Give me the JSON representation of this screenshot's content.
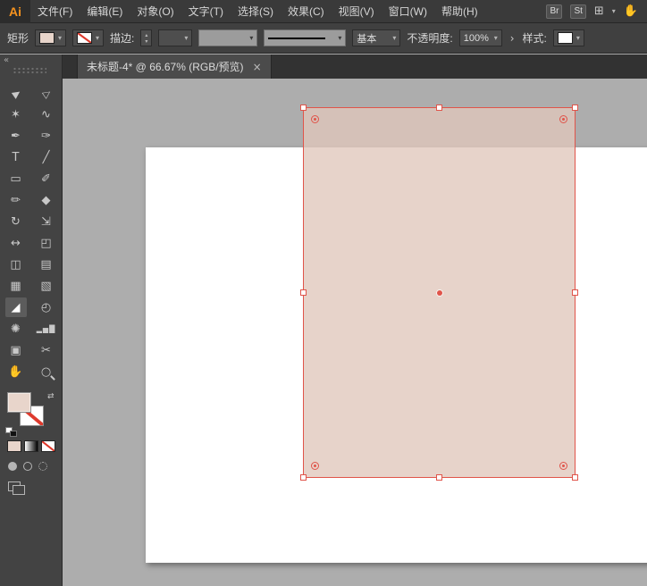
{
  "menubar": {
    "logo": "Ai",
    "items": [
      "文件(F)",
      "编辑(E)",
      "对象(O)",
      "文字(T)",
      "选择(S)",
      "效果(C)",
      "视图(V)",
      "窗口(W)",
      "帮助(H)"
    ],
    "br_badge": "Br",
    "st_badge": "St"
  },
  "controlbar": {
    "tool_label": "矩形",
    "stroke_label": "描边:",
    "brush_name": "基本",
    "opacity_label": "不透明度:",
    "opacity_value": "100%",
    "style_label": "样式:"
  },
  "tabbar": {
    "tab_title": "未标题-4* @ 66.67% (RGB/预览)"
  },
  "toolbar": {
    "tools": [
      {
        "name": "selection-tool",
        "glyph": "▶"
      },
      {
        "name": "direct-selection-tool",
        "glyph": "▷"
      },
      {
        "name": "magic-wand-tool",
        "glyph": "✶"
      },
      {
        "name": "lasso-tool",
        "glyph": "∿"
      },
      {
        "name": "pen-tool",
        "glyph": "✒"
      },
      {
        "name": "curvature-tool",
        "glyph": "✑"
      },
      {
        "name": "type-tool",
        "glyph": "T"
      },
      {
        "name": "line-segment-tool",
        "glyph": "╱"
      },
      {
        "name": "rectangle-tool",
        "glyph": "▭"
      },
      {
        "name": "paintbrush-tool",
        "glyph": "✐"
      },
      {
        "name": "pencil-tool",
        "glyph": "✏"
      },
      {
        "name": "eraser-tool",
        "glyph": "◆"
      },
      {
        "name": "rotate-tool",
        "glyph": "↻"
      },
      {
        "name": "scale-tool",
        "glyph": "⇲"
      },
      {
        "name": "width-tool",
        "glyph": "↔"
      },
      {
        "name": "free-transform-tool",
        "glyph": "◰"
      },
      {
        "name": "shape-builder-tool",
        "glyph": "◫"
      },
      {
        "name": "perspective-grid-tool",
        "glyph": "▤"
      },
      {
        "name": "mesh-tool",
        "glyph": "▦"
      },
      {
        "name": "gradient-tool",
        "glyph": "▧"
      },
      {
        "name": "eyedropper-tool",
        "glyph": "◢"
      },
      {
        "name": "blend-tool",
        "glyph": "◴"
      },
      {
        "name": "symbol-sprayer-tool",
        "glyph": "✺"
      },
      {
        "name": "column-graph-tool",
        "glyph": "▂▅█"
      },
      {
        "name": "artboard-tool",
        "glyph": "▣"
      },
      {
        "name": "slice-tool",
        "glyph": "✂"
      },
      {
        "name": "hand-tool",
        "glyph": "✋"
      },
      {
        "name": "zoom-tool",
        "glyph": "○"
      }
    ]
  },
  "icons": {
    "caret_down": "▾",
    "spinner_up": "▴",
    "spinner_down": "▾",
    "expand": "›",
    "collapse": "«",
    "close": "×",
    "swap": "⇄",
    "arrange_documents": "⊞",
    "touch_workspace": "✋"
  },
  "colors": {
    "accent_orange": "#f7931e",
    "selection_red": "#e0544a",
    "fill_pink": "#e8d5cb",
    "canvas_gray": "#adadad"
  }
}
